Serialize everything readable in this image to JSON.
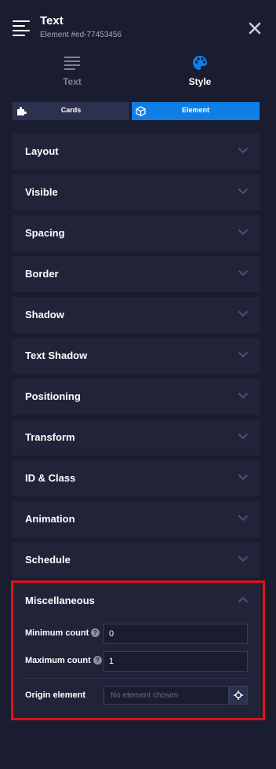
{
  "header": {
    "title": "Text",
    "subtitle": "Element #ed-77453456",
    "menu_icon": "hamburger-text-icon",
    "close_icon": "close-icon"
  },
  "tabs": [
    {
      "label": "Text",
      "icon": "text-lines-icon",
      "active": false
    },
    {
      "label": "Style",
      "icon": "palette-icon",
      "active": true
    }
  ],
  "segments": [
    {
      "label": "Cards",
      "icon": "puzzle-icon",
      "active": false
    },
    {
      "label": "Element",
      "icon": "cube-icon",
      "active": true
    }
  ],
  "sections": [
    "Layout",
    "Visible",
    "Spacing",
    "Border",
    "Shadow",
    "Text Shadow",
    "Positioning",
    "Transform",
    "ID & Class",
    "Animation",
    "Schedule"
  ],
  "misc": {
    "title": "Miscellaneous",
    "expanded": true,
    "min_count": {
      "label": "Minimum count",
      "value": "0"
    },
    "max_count": {
      "label": "Maximum count",
      "value": "1"
    },
    "origin": {
      "label": "Origin element",
      "placeholder": "No element chosen",
      "button_icon": "crosshair-icon"
    }
  },
  "colors": {
    "background": "#1a1d30",
    "panel": "#212439",
    "accent": "#0f7fe6",
    "highlight": "#e01218"
  }
}
